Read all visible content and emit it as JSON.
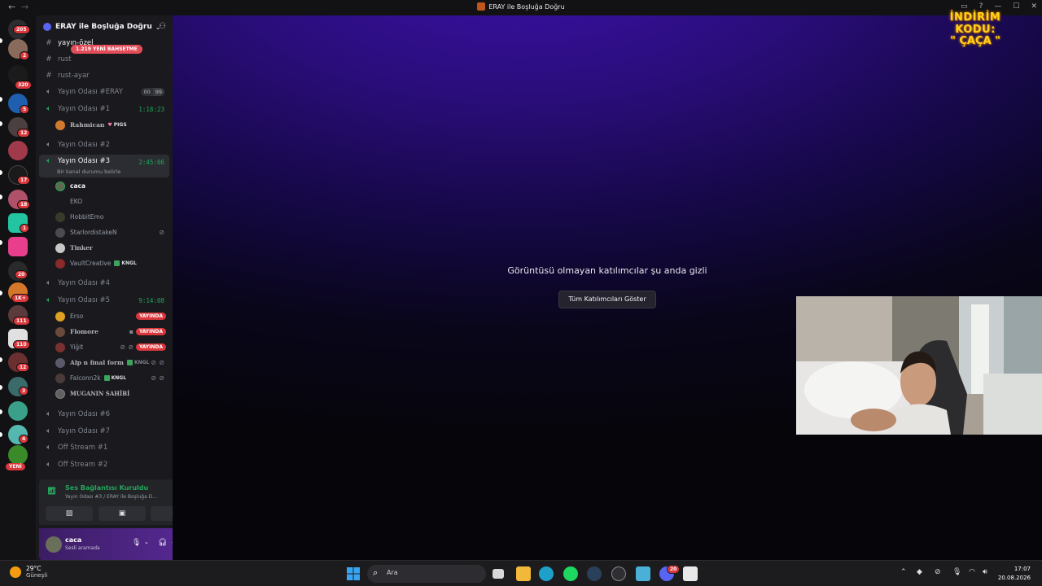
{
  "window": {
    "title": "ERAY ile Boşluğa Doğru"
  },
  "rail": {
    "badges": [
      "205",
      "2",
      "320",
      "5",
      "12",
      "17",
      "18",
      "1",
      "20",
      "1K+",
      "111",
      "110",
      "12",
      "3",
      "4"
    ],
    "new_label": "YENİ"
  },
  "guild": {
    "name": "ERAY ile Boşluğa Doğru",
    "mention_pill": "1.219 YENİ BAHSETME"
  },
  "channels": [
    {
      "name": "yayın-özel",
      "type": "text"
    },
    {
      "name": "rust",
      "type": "text"
    },
    {
      "name": "rust-ayar",
      "type": "text"
    },
    {
      "name": "Yayın Odası #ERAY",
      "type": "voice",
      "count_a": "00",
      "count_b": "99"
    },
    {
      "name": "Yayın Odası #1",
      "type": "voice",
      "timer": "1:18:23"
    },
    {
      "name": "Yayın Odası #2",
      "type": "voice"
    },
    {
      "name": "Yayın Odası #3",
      "type": "voice",
      "timer": "2:45:06",
      "status": "Bir kanal durumu belirle"
    },
    {
      "name": "Yayın Odası #4",
      "type": "voice"
    },
    {
      "name": "Yayın Odası #5",
      "type": "voice",
      "timer": "9:14:08"
    },
    {
      "name": "Yayın Odası #6",
      "type": "voice"
    },
    {
      "name": "Yayın Odası #7",
      "type": "voice"
    },
    {
      "name": "Off Stream #1",
      "type": "voice"
    },
    {
      "name": "Off Stream #2",
      "type": "voice"
    }
  ],
  "voice_users": {
    "room1": [
      {
        "name": "Rahmican",
        "tag": "PIGS"
      }
    ],
    "room3": [
      {
        "name": "caca"
      },
      {
        "name": "EKO"
      },
      {
        "name": "HobbitEmo"
      },
      {
        "name": "StarlordistakeN"
      },
      {
        "name": "Tinker"
      },
      {
        "name": "VaultCreative",
        "tag": "KNGL"
      }
    ],
    "room5": [
      {
        "name": "Erso",
        "live": "YAYINDA"
      },
      {
        "name": "Flomore",
        "live": "YAYINDA"
      },
      {
        "name": "Yiğit",
        "live": "YAYINDA"
      },
      {
        "name": "Alp n final form",
        "tag": "KNGL"
      },
      {
        "name": "Falconn2k",
        "tag": "KNGL"
      },
      {
        "name": "MUGANIN SAHİBİ"
      }
    ]
  },
  "voice_panel": {
    "title": "Ses Bağlantısı Kuruldu",
    "subtitle": "Yayın Odası #3 / ERAY ile Boşluğa D..."
  },
  "user_panel": {
    "name": "caca",
    "status": "Sesli aramada"
  },
  "stage": {
    "message": "Görüntüsü olmayan katılımcılar şu anda gizli",
    "button": "Tüm Katılımcıları Göster"
  },
  "overlay": {
    "promo_line1": "İNDİRİM KODU:",
    "promo_line2": "\" ÇAÇA \""
  },
  "taskbar": {
    "temp": "29°C",
    "weather": "Güneşli",
    "search_placeholder": "Ara",
    "time": "17:07",
    "date": "20.08.2026",
    "discord_badge": "20"
  }
}
